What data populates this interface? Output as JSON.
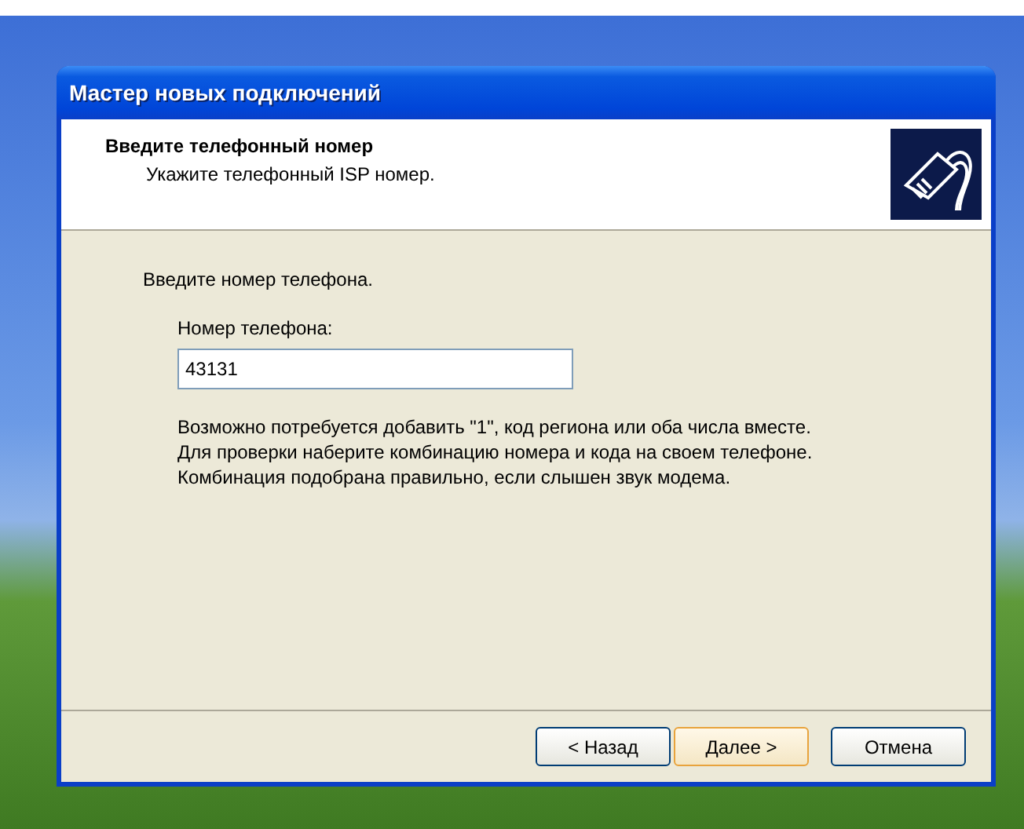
{
  "window": {
    "title": "Мастер новых подключений"
  },
  "header": {
    "title": "Введите телефонный номер",
    "subtitle": "Укажите телефонный  ISP номер."
  },
  "body": {
    "intro": "Введите номер телефона.",
    "field_label": "Номер телефона:",
    "field_value": "43131",
    "hint": [
      "Возможно потребуется добавить \"1\", код региона или оба числа вместе.",
      "Для проверки наберите комбинацию номера и кода на своем телефоне.",
      "Комбинация подобрана правильно, если слышен звук модема."
    ]
  },
  "buttons": [
    {
      "label": "< Назад",
      "default": false
    },
    {
      "label": "Далее >",
      "default": true
    },
    {
      "label": "Отмена",
      "default": false
    }
  ]
}
